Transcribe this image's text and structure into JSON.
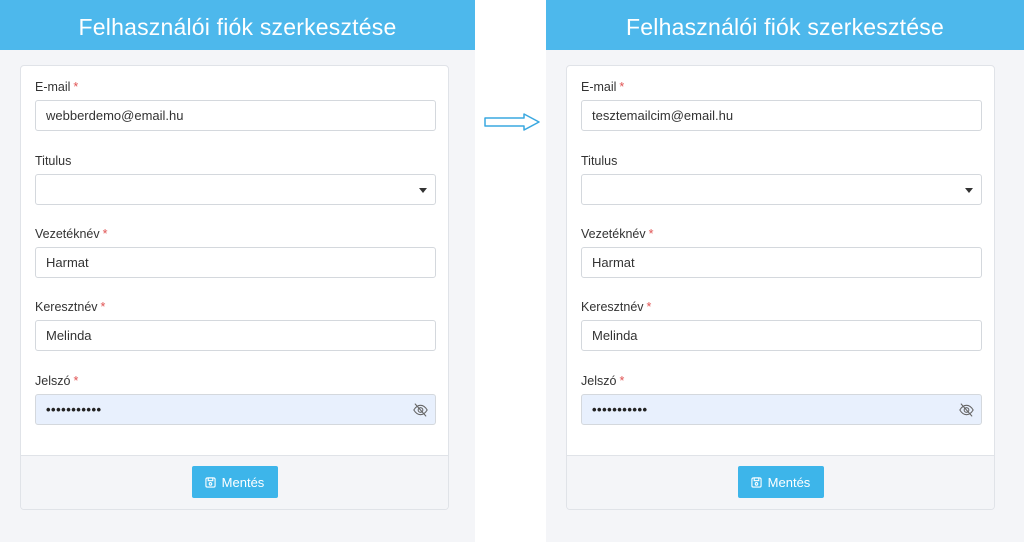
{
  "left": {
    "title": "Felhasználói fiók szerkesztése",
    "email": {
      "label": "E-mail",
      "value": "webberdemo@email.hu"
    },
    "title_field": {
      "label": "Titulus",
      "value": ""
    },
    "lastname": {
      "label": "Vezetéknév",
      "value": "Harmat"
    },
    "firstname": {
      "label": "Keresztnév",
      "value": "Melinda"
    },
    "password": {
      "label": "Jelszó",
      "value": "•••••••••••"
    },
    "save_label": "Mentés"
  },
  "right": {
    "title": "Felhasználói fiók szerkesztése",
    "email": {
      "label": "E-mail",
      "value": "tesztemailcim@email.hu"
    },
    "title_field": {
      "label": "Titulus",
      "value": ""
    },
    "lastname": {
      "label": "Vezetéknév",
      "value": "Harmat"
    },
    "firstname": {
      "label": "Keresztnév",
      "value": "Melinda"
    },
    "password": {
      "label": "Jelszó",
      "value": "•••••••••••"
    },
    "save_label": "Mentés"
  },
  "required_mark": "*",
  "colors": {
    "accent": "#4db8ec",
    "button": "#3db5ea",
    "required": "#e05252",
    "arrow": "#3aa8e0"
  },
  "icons": {
    "arrow": "right-arrow-outline-icon",
    "eye": "eye-slash-icon",
    "save": "save-icon",
    "select": "caret-down-icon"
  }
}
